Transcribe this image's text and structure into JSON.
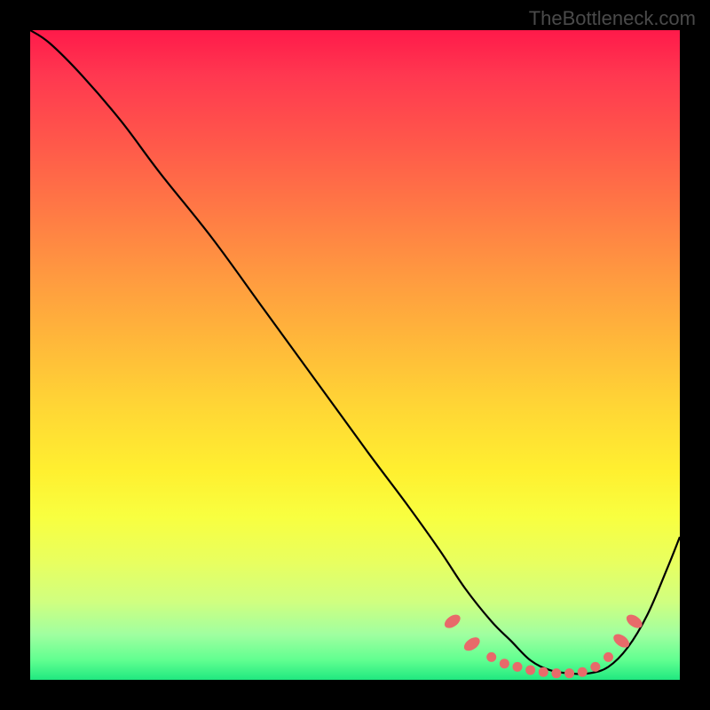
{
  "watermark": "TheBottleneck.com",
  "chart_data": {
    "type": "line",
    "title": "",
    "xlabel": "",
    "ylabel": "",
    "xlim": [
      0,
      100
    ],
    "ylim": [
      0,
      100
    ],
    "grid": false,
    "legend": false,
    "series": [
      {
        "name": "bottleneck-curve",
        "x": [
          0,
          3,
          8,
          14,
          20,
          28,
          36,
          44,
          52,
          58,
          63,
          67,
          71,
          74,
          77,
          80,
          83,
          86,
          89,
          92,
          95,
          98,
          100
        ],
        "y": [
          100,
          98,
          93,
          86,
          78,
          68,
          57,
          46,
          35,
          27,
          20,
          14,
          9,
          6,
          3,
          1.5,
          1,
          1,
          2,
          5,
          10,
          17,
          22
        ],
        "color": "#000000"
      }
    ],
    "markers": {
      "name": "optimal-zone-dots",
      "color": "#e86a6a",
      "points": [
        {
          "x": 65,
          "y": 9
        },
        {
          "x": 68,
          "y": 5.5
        },
        {
          "x": 71,
          "y": 3.5
        },
        {
          "x": 73,
          "y": 2.5
        },
        {
          "x": 75,
          "y": 2
        },
        {
          "x": 77,
          "y": 1.5
        },
        {
          "x": 79,
          "y": 1.2
        },
        {
          "x": 81,
          "y": 1
        },
        {
          "x": 83,
          "y": 1
        },
        {
          "x": 85,
          "y": 1.2
        },
        {
          "x": 87,
          "y": 2
        },
        {
          "x": 89,
          "y": 3.5
        },
        {
          "x": 91,
          "y": 6
        },
        {
          "x": 93,
          "y": 9
        }
      ]
    },
    "background_gradient": {
      "top": "#ff1a4a",
      "middle": "#ffd635",
      "bottom": "#20e880"
    }
  }
}
